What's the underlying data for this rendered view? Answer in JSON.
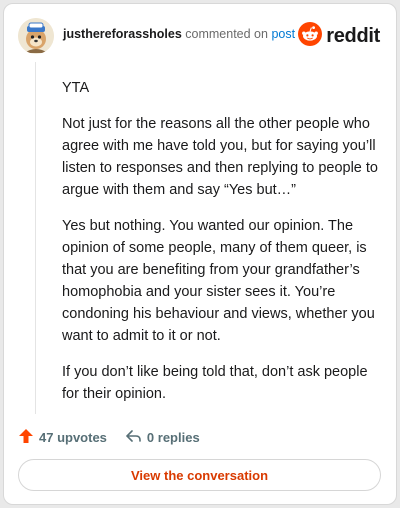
{
  "header": {
    "username": "justhereforassholes",
    "action_text": "commented on",
    "post_link": "post"
  },
  "comment": {
    "paragraphs": [
      "YTA",
      "Not just for the reasons all the other people who agree with me have told you, but for saying you’ll listen to responses and then replying to people to argue with them and say “Yes but…”",
      "Yes but nothing. You wanted our opinion. The opinion of some people, many of them queer, is that you are benefiting from your grandfather’s homophobia and your sister sees it. You’re condoning his behaviour and views, whether you want to admit to it or not.",
      "If you don’t like being told that, don’t ask people for their opinion."
    ]
  },
  "actions": {
    "upvotes": "47 upvotes",
    "replies": "0 replies"
  },
  "button": {
    "view_label": "View the conversation"
  },
  "brand": {
    "wordmark": "reddit"
  },
  "colors": {
    "accent": "#ff4500",
    "link": "#0079d3",
    "button_text": "#d93a00",
    "upvote": "#ff4500"
  },
  "icons": {
    "avatar": "avatar-icon",
    "brand": "reddit-logo-icon",
    "upvote": "upvote-arrow-icon",
    "reply": "reply-icon"
  }
}
